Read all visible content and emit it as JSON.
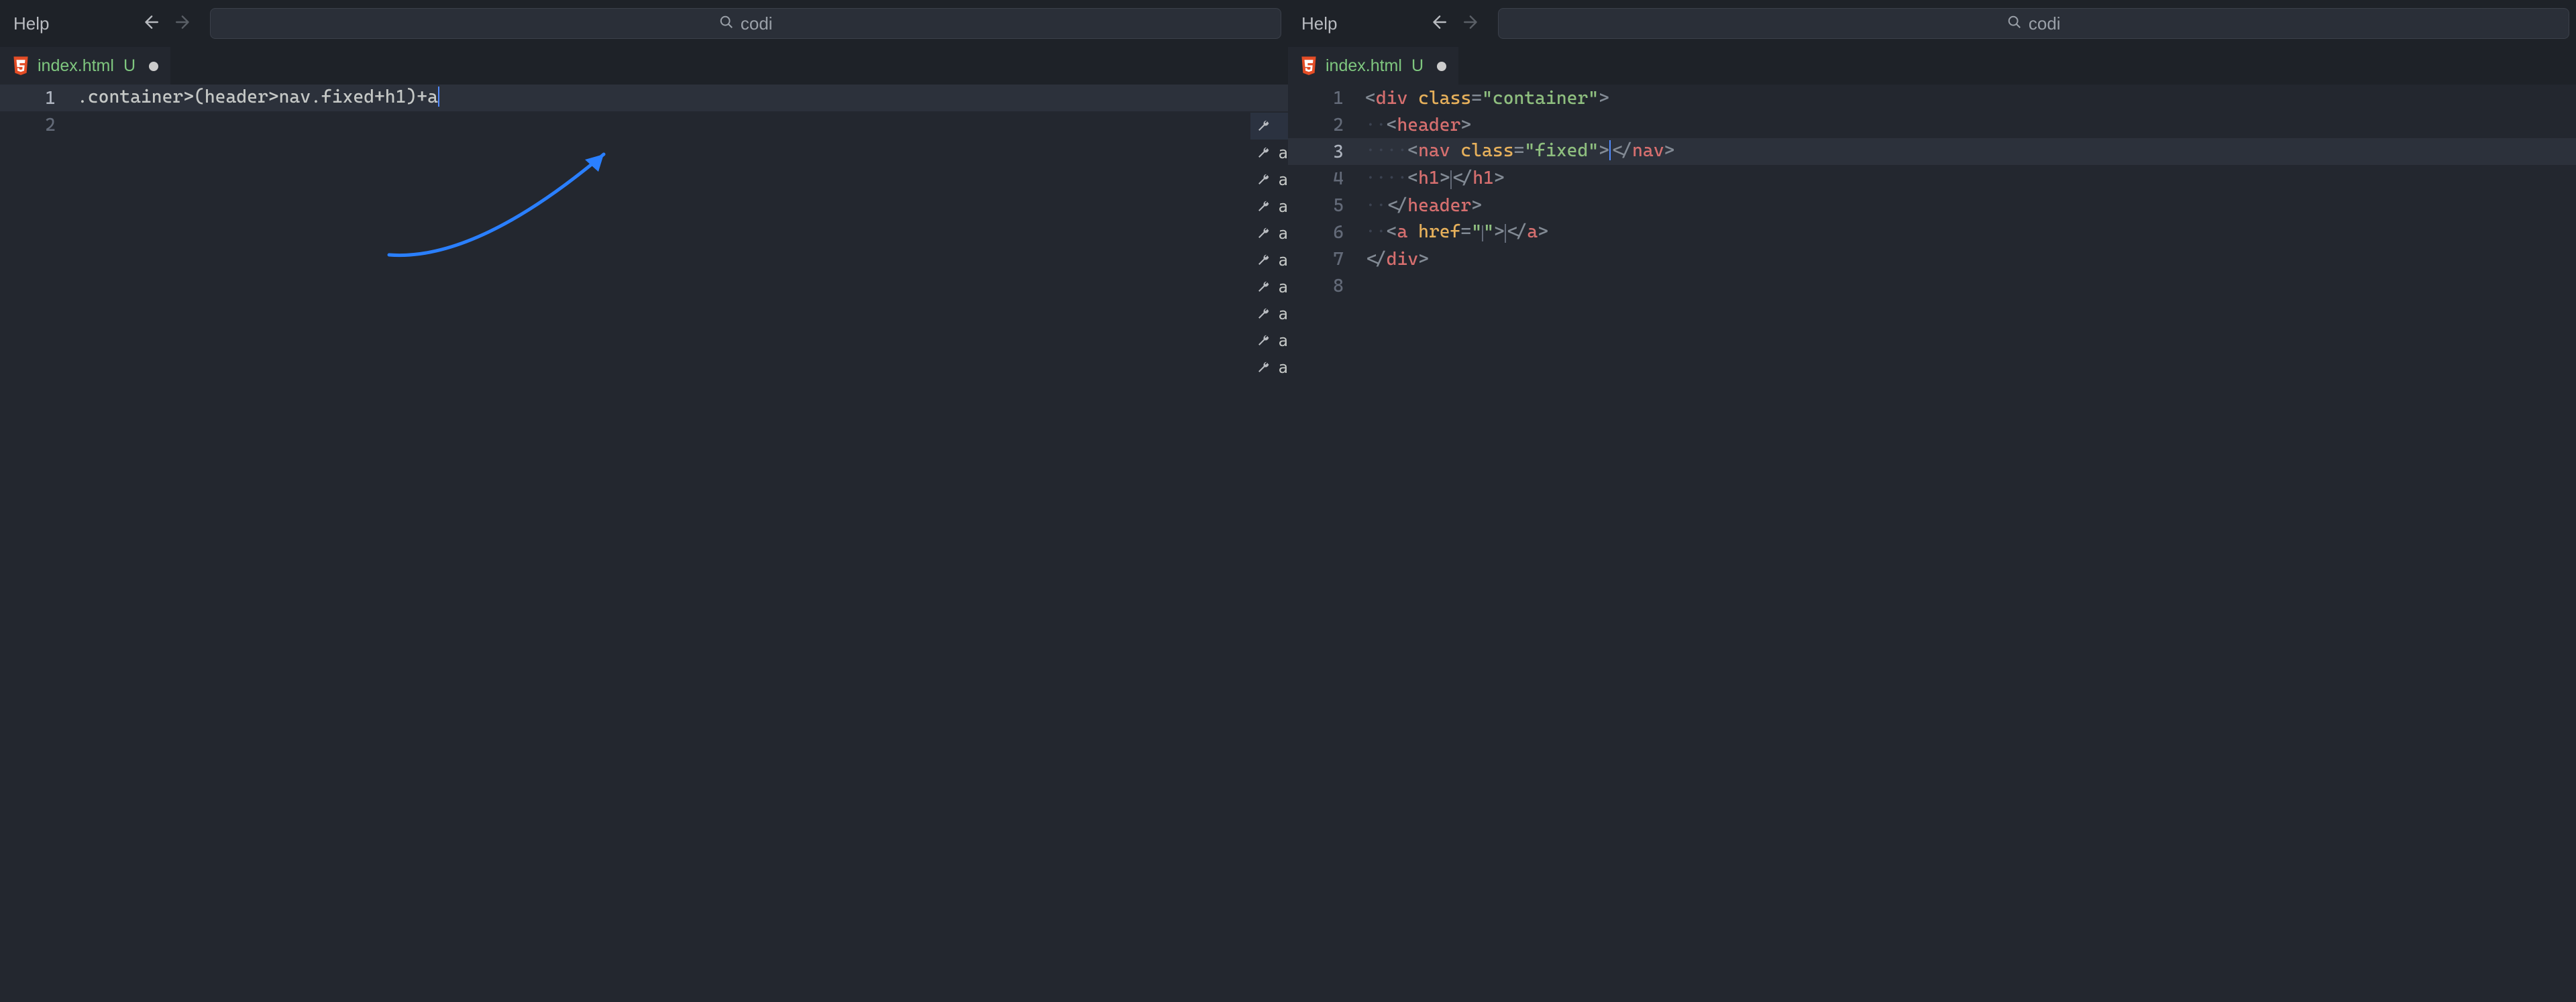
{
  "menu": {
    "help": "Help"
  },
  "search": {
    "placeholder": "codi"
  },
  "tab": {
    "filename": "index.html",
    "git_status": "U"
  },
  "left_editor": {
    "emmet_input": ".container>(header>nav.fixed+h1)+a",
    "line_numbers": [
      "1",
      "2"
    ],
    "suggest_visible_label": "a"
  },
  "right_editor": {
    "line_numbers": [
      "1",
      "2",
      "3",
      "4",
      "5",
      "6",
      "7",
      "8"
    ],
    "code": {
      "l1": {
        "tag": "div",
        "attr": "class",
        "val": "container"
      },
      "l2": {
        "ws": "··",
        "tag": "header"
      },
      "l3": {
        "ws": "····",
        "tag": "nav",
        "attr": "class",
        "val": "fixed"
      },
      "l4": {
        "ws": "····",
        "tag": "h1"
      },
      "l5": {
        "ws": "··",
        "tag": "header"
      },
      "l6": {
        "ws": "··",
        "tag": "a",
        "attr": "href",
        "val": ""
      },
      "l7": {
        "tag": "div"
      }
    }
  },
  "suggest_icon_count": 10
}
